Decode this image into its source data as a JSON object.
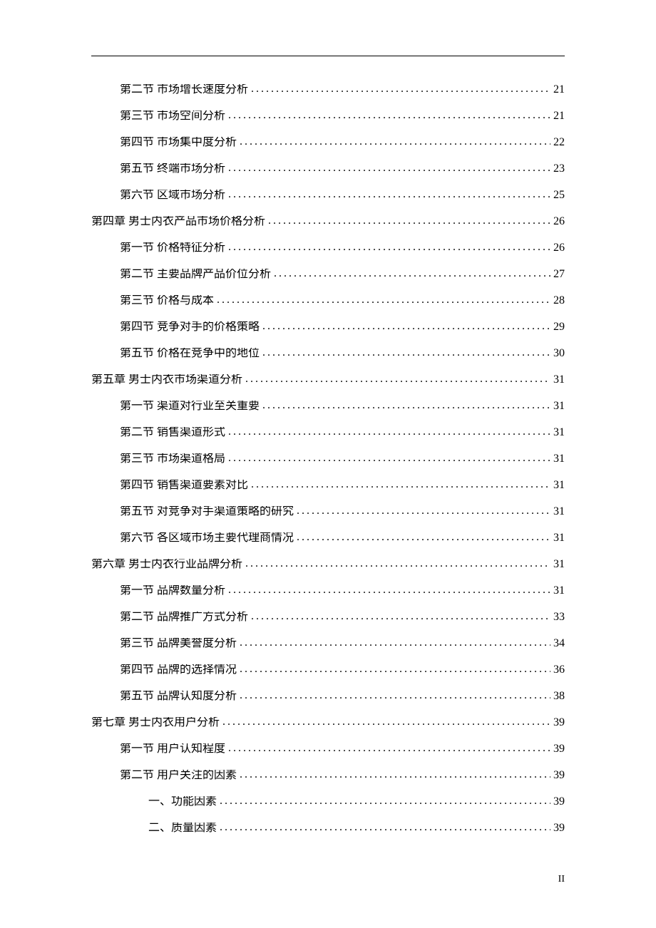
{
  "page_footer": "II",
  "entries": [
    {
      "indent": 2,
      "label": "第二节 市场增长速度分析",
      "page": "21"
    },
    {
      "indent": 2,
      "label": "第三节 市场空间分析",
      "page": "21"
    },
    {
      "indent": 2,
      "label": "第四节 市场集中度分析",
      "page": "22"
    },
    {
      "indent": 2,
      "label": "第五节 终端市场分析",
      "page": "23"
    },
    {
      "indent": 2,
      "label": "第六节 区域市场分析",
      "page": "25"
    },
    {
      "indent": 1,
      "label": "第四章 男士内衣产品市场价格分析",
      "page": "26"
    },
    {
      "indent": 2,
      "label": "第一节 价格特征分析",
      "page": "26"
    },
    {
      "indent": 2,
      "label": "第二节 主要品牌产品价位分析",
      "page": "27"
    },
    {
      "indent": 2,
      "label": "第三节 价格与成本",
      "page": "28"
    },
    {
      "indent": 2,
      "label": "第四节 竞争对手的价格策略",
      "page": "29"
    },
    {
      "indent": 2,
      "label": "第五节 价格在竞争中的地位",
      "page": "30"
    },
    {
      "indent": 1,
      "label": "第五章 男士内衣市场渠道分析",
      "page": "31"
    },
    {
      "indent": 2,
      "label": "第一节 渠道对行业至关重要",
      "page": "31"
    },
    {
      "indent": 2,
      "label": "第二节 销售渠道形式",
      "page": "31"
    },
    {
      "indent": 2,
      "label": "第三节 市场渠道格局",
      "page": "31"
    },
    {
      "indent": 2,
      "label": "第四节 销售渠道要素对比",
      "page": "31"
    },
    {
      "indent": 2,
      "label": "第五节 对竞争对手渠道策略的研究",
      "page": "31"
    },
    {
      "indent": 2,
      "label": "第六节 各区域市场主要代理商情况",
      "page": "31"
    },
    {
      "indent": 1,
      "label": "第六章 男士内衣行业品牌分析",
      "page": "31"
    },
    {
      "indent": 2,
      "label": "第一节 品牌数量分析",
      "page": "31"
    },
    {
      "indent": 2,
      "label": "第二节 品牌推广方式分析",
      "page": "33"
    },
    {
      "indent": 2,
      "label": "第三节 品牌美誉度分析",
      "page": "34"
    },
    {
      "indent": 2,
      "label": "第四节 品牌的选择情况",
      "page": "36"
    },
    {
      "indent": 2,
      "label": "第五节 品牌认知度分析",
      "page": "38"
    },
    {
      "indent": 1,
      "label": "第七章 男士内衣用户分析",
      "page": "39"
    },
    {
      "indent": 2,
      "label": "第一节 用户认知程度",
      "page": "39"
    },
    {
      "indent": 2,
      "label": "第二节 用户关注的因素",
      "page": "39"
    },
    {
      "indent": 3,
      "label": "一、功能因素",
      "page": "39"
    },
    {
      "indent": 3,
      "label": "二、质量因素",
      "page": "39"
    }
  ]
}
